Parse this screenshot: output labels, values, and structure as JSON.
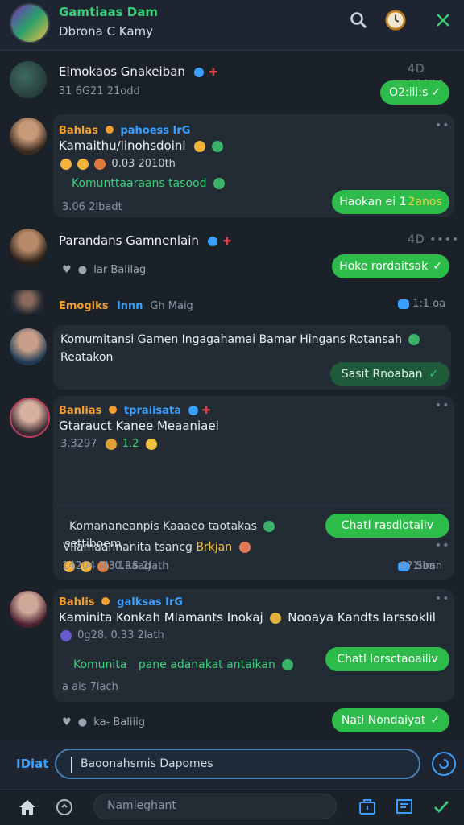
{
  "header": {
    "title": "Gamtiaas Dam",
    "subtitle": "Dbrona C Kamy",
    "icons": [
      "search-icon",
      "clock-icon",
      "close-icon"
    ]
  },
  "messages": [
    {
      "name": "Eimokaos Gnakeiban",
      "time": "31 6G21 21odd",
      "dots": "4D •••••",
      "button": "O2:ili:s"
    },
    {
      "tag1": "Bahlas",
      "tag2": "pahoess IrG",
      "name": "Kamaithu/linohsdoini",
      "stats": "0.03 2010th",
      "green_line": "Komunttaaraans tasood",
      "time": "3.06 2Ibadt",
      "button": "Haokan ei 1",
      "button_highlight": "2anos",
      "dots": "••"
    },
    {
      "name": "Parandans Gamnenlain",
      "reply": "lar Balilag",
      "dots": "4D ••••",
      "button": "Hoke rordaitsak"
    },
    {
      "tag1": "Emogiks",
      "tag2": "lnnn",
      "tag3": "Gh Maig",
      "count": "1:1 oa"
    },
    {
      "text": "Komumitansi Gamen Ingagahamai Bamar Hingans Rotansah",
      "text2": "Reatakon",
      "button": "Sasit Rnoaban"
    },
    {
      "tag1": "Banlias",
      "tag2": "tpraiisata",
      "name": "Gtarauct Kanee Meaaniaei",
      "stats": "3.3297",
      "stat2": "1.2",
      "green_button": "Chatl rasdlotaiiv",
      "inner_text": "Komananeanpis Kaaaeo taotakas",
      "inner_text2": "settiboem",
      "inner_stats": "0.RS 2lath",
      "inner_count": "1:oa",
      "line3": "Vilamaannanita tsancg",
      "line3_hl": "Brkjan",
      "time_left": "14204 3I3 1aaag",
      "time_right": "0? Slmn",
      "dots": "••"
    },
    {
      "tag1": "Bahlis",
      "tag2": "galksas IrG",
      "name": "Kaminita Konkah Mlamants Inokaj",
      "name2": "Nooaya Kandts Iarssoklil",
      "stats": "0g28. 0.33 2lath",
      "green_line": "Komunita",
      "green_line2": "pane adanakat antaikan",
      "green_button": "Chatl lorsctaoailiv",
      "time": "a ais 7lach",
      "reply": "ka- Baliiig",
      "button": "Nati Nondaiyat",
      "dots": "••"
    }
  ],
  "composer": {
    "left_label": "IDiat",
    "input_value": "Baoonahsmis Dapomes"
  },
  "bottom_bar": {
    "search_placeholder": "Namleghant",
    "icons": [
      "home-icon",
      "refresh-icon",
      "bag-icon",
      "news-icon",
      "check-icon"
    ]
  },
  "colors": {
    "background": "#1b2129",
    "bubble": "#232b35",
    "accent_green": "#2dbb4a",
    "text_green": "#3ad07a",
    "tag_orange": "#f0a030",
    "tag_blue": "#3aa0ff",
    "input_border": "#4a7fb8"
  }
}
